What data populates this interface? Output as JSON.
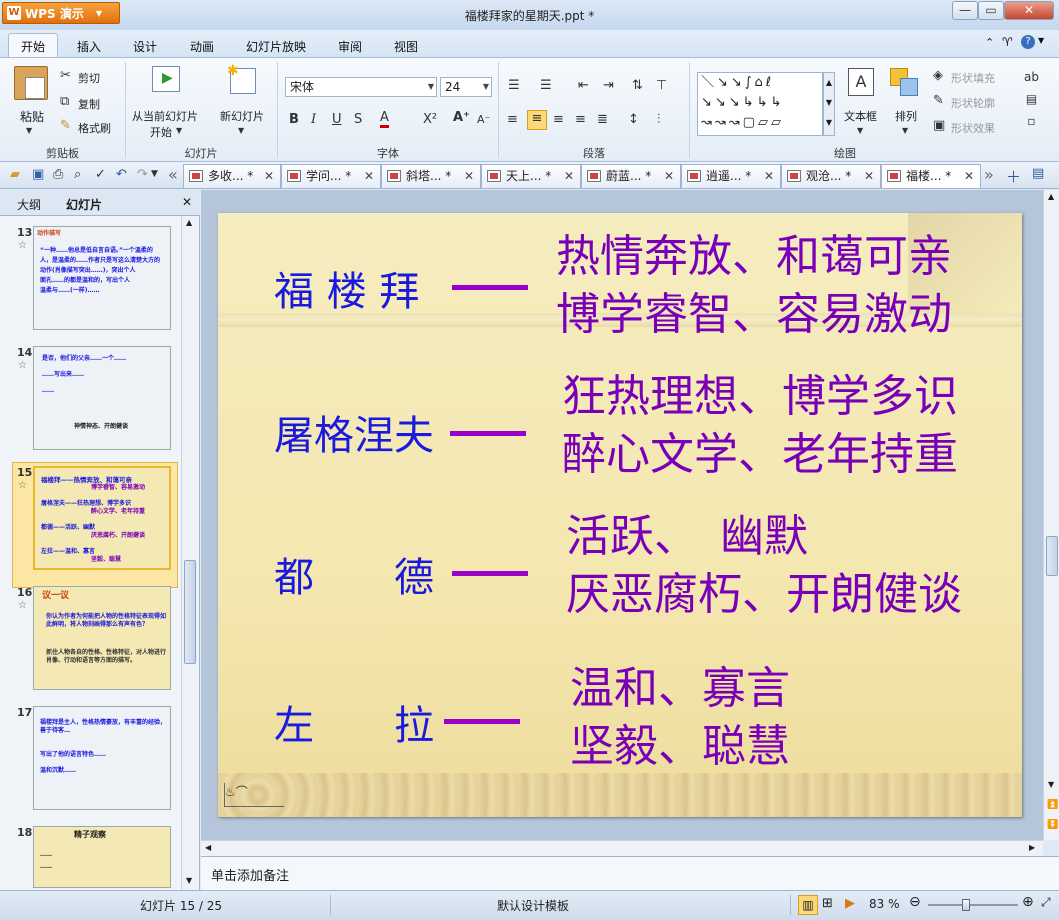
{
  "app": {
    "name": "WPS 演示",
    "title": "福楼拜家的星期天.ppt *"
  },
  "menu": [
    "开始",
    "插入",
    "设计",
    "动画",
    "幻灯片放映",
    "审阅",
    "视图"
  ],
  "ribbon": {
    "paste": "粘贴",
    "cut": "剪切",
    "copy": "复制",
    "format_painter": "格式刷",
    "clipboard_group": "剪贴板",
    "from_current": [
      "从当前幻灯片",
      "开始"
    ],
    "new_slide": "新幻灯片",
    "slides_group": "幻灯片",
    "font_name": "宋体",
    "font_size": "24",
    "font_group": "字体",
    "paragraph_group": "段落",
    "textbox": "文本框",
    "arrange": "排列",
    "drawing_group": "绘图",
    "shape_fill": "形状填充",
    "shape_outline": "形状轮廓",
    "shape_effect": "形状效果"
  },
  "doc_tabs": [
    "多收... *",
    "学问... *",
    "斜塔... *",
    "天上... *",
    "蔚蓝... *",
    "逍遥... *",
    "观沧... *",
    "福楼... *"
  ],
  "panel": {
    "tab_outline": "大纲",
    "tab_slides": "幻灯片"
  },
  "thumbnails": [
    {
      "num": "13",
      "lines": [
        "动作描写",
        "“一种……他总是低自言自语。”一个温柔的",
        "人，是温柔的……作者只是写这么清楚大方的",
        "动作(肖像描写突出……)，突出个人",
        "面孔……的都是温和的，写出个人",
        "温柔与……(一样)……"
      ]
    },
    {
      "num": "14",
      "lines": [
        "是否，他们的父亲……一个……",
        "……写出来……",
        "……",
        "神情神态、开朗健谈"
      ]
    },
    {
      "num": "15",
      "lines": [
        "福楼拜——热情奔放、和蔼可亲",
        "博学睿智、容易激动",
        "屠格涅夫——狂热理想、博学多识",
        "醉心文学、老年持重",
        "都德——活跃、幽默",
        "厌恶腐朽、开朗健谈",
        "左拉——温和、寡言",
        "坚毅、聪慧"
      ]
    },
    {
      "num": "16",
      "lines": [
        "议一议",
        "你认为作者为何能把人物的性格特征表现得如此鲜明，将人物刻画得那么有声有色？",
        "抓住人物各自的性格、性格特征，对人物进行肖像、行动和语言等方面的描写。"
      ]
    },
    {
      "num": "17",
      "lines": [
        "福楼拜是主人，性格热情豪放，有丰富的经验，善于待客…",
        "写出了他的语言特色……",
        "温和沉默……"
      ]
    },
    {
      "num": "18",
      "lines": [
        "精子观察",
        "……",
        "……"
      ]
    }
  ],
  "slide": {
    "rows": [
      {
        "name": "福 楼 拜",
        "desc1": "热情奔放、和蔼可亲",
        "desc2": "博学睿智、容易激动"
      },
      {
        "name": "屠格涅夫",
        "desc1": "狂热理想、博学多识",
        "desc2": "醉心文学、老年持重"
      },
      {
        "name": "都　　德",
        "desc1": "活跃、　幽默",
        "desc2": "厌恶腐朽、开朗健谈"
      },
      {
        "name": "左　　拉",
        "desc1": "温和、寡言",
        "desc2": "坚毅、聪慧"
      }
    ]
  },
  "notes_placeholder": "单击添加备注",
  "status": {
    "slide_info": "幻灯片 15 / 25",
    "template": "默认设计模板",
    "zoom": "83 %"
  }
}
